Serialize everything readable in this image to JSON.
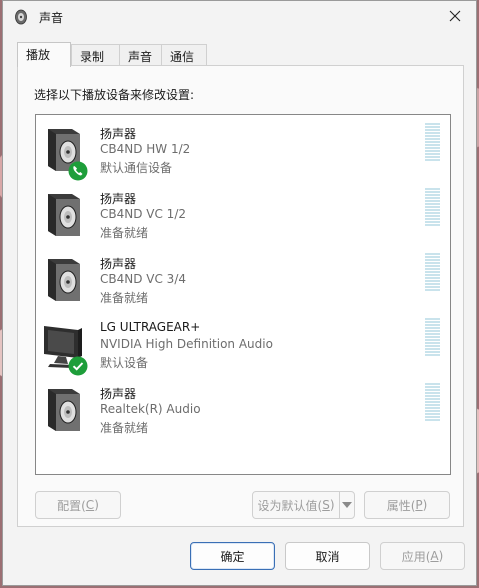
{
  "window": {
    "title": "声音",
    "close_label": "✕"
  },
  "tabs": [
    {
      "label": "播放"
    },
    {
      "label": "录制"
    },
    {
      "label": "声音"
    },
    {
      "label": "通信"
    }
  ],
  "instruction": "选择以下播放设备来修改设置:",
  "devices": [
    {
      "name": "扬声器",
      "description": "CB4ND HW 1/2",
      "status": "默认通信设备",
      "icon": "speaker-icon",
      "badge": "phone-badge-icon"
    },
    {
      "name": "扬声器",
      "description": "CB4ND VC 1/2",
      "status": "准备就绪",
      "icon": "speaker-icon",
      "badge": ""
    },
    {
      "name": "扬声器",
      "description": "CB4ND VC 3/4",
      "status": "准备就绪",
      "icon": "speaker-icon",
      "badge": ""
    },
    {
      "name": "LG ULTRAGEAR+",
      "description": "NVIDIA High Definition Audio",
      "status": "默认设备",
      "icon": "monitor-icon",
      "badge": "check-badge-icon"
    },
    {
      "name": "扬声器",
      "description": "Realtek(R) Audio",
      "status": "准备就绪",
      "icon": "speaker-icon",
      "badge": ""
    }
  ],
  "buttons": {
    "configure": {
      "text": "配置(",
      "key": "C",
      "tail": ")"
    },
    "set_default": {
      "text": "设为默认值(",
      "key": "S",
      "tail": ")"
    },
    "properties": {
      "text": "属性(",
      "key": "P",
      "tail": ")"
    },
    "ok": "确定",
    "cancel": "取消",
    "apply": {
      "text": "应用(",
      "key": "A",
      "tail": ")"
    }
  },
  "colors": {
    "badge_green": "#1e9e3a",
    "accent_blue": "#3a6fb5",
    "meter": "#c9e3ec"
  }
}
